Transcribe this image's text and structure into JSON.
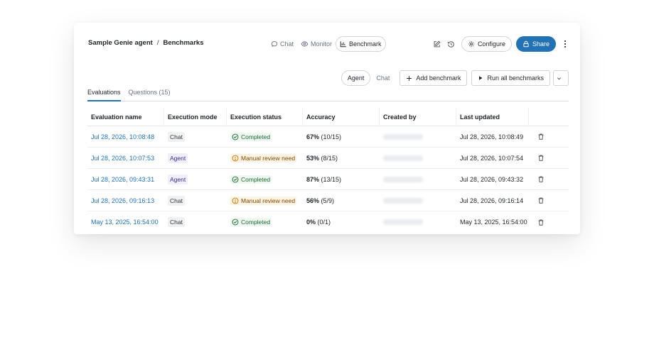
{
  "breadcrumb": {
    "agent": "Sample Genie agent",
    "separator": "/",
    "page": "Benchmarks"
  },
  "modes": [
    {
      "label": "Chat",
      "icon": "chat-bubble-icon",
      "active": false
    },
    {
      "label": "Monitor",
      "icon": "eye-icon",
      "active": false
    },
    {
      "label": "Benchmark",
      "icon": "bar-chart-icon",
      "active": true
    }
  ],
  "header": {
    "configure_label": "Configure",
    "share_label": "Share"
  },
  "toolbar": {
    "segment": [
      {
        "label": "Agent",
        "active": true
      },
      {
        "label": "Chat",
        "active": false
      }
    ],
    "add_benchmark_label": "Add benchmark",
    "run_all_label": "Run all benchmarks"
  },
  "tabs": [
    {
      "label": "Evaluations",
      "active": true
    },
    {
      "label": "Questions (15)",
      "active": false
    }
  ],
  "table": {
    "columns": [
      "Evaluation name",
      "Execution mode",
      "Execution status",
      "Accuracy",
      "Created by",
      "Last updated",
      ""
    ],
    "rows": [
      {
        "name": "Jul 28, 2026, 10:08:48",
        "mode": "Chat",
        "status": "Completed",
        "status_type": "ok",
        "acc_pct": "67%",
        "acc_frac": "(10/15)",
        "updated": "Jul 28, 2026, 10:08:49"
      },
      {
        "name": "Jul 28, 2026, 10:07:53",
        "mode": "Agent",
        "status": "Manual review need",
        "status_type": "warn",
        "acc_pct": "53%",
        "acc_frac": "(8/15)",
        "updated": "Jul 28, 2026, 10:07:54"
      },
      {
        "name": "Jul 28, 2026, 09:43:31",
        "mode": "Agent",
        "status": "Completed",
        "status_type": "ok",
        "acc_pct": "87%",
        "acc_frac": "(13/15)",
        "updated": "Jul 28, 2026, 09:43:32"
      },
      {
        "name": "Jul 28, 2026, 09:16:13",
        "mode": "Chat",
        "status": "Manual review need",
        "status_type": "warn",
        "acc_pct": "56%",
        "acc_frac": "(5/9)",
        "updated": "Jul 28, 2026, 09:16:14"
      },
      {
        "name": "May 13, 2025, 16:54:00",
        "mode": "Chat",
        "status": "Completed",
        "status_type": "ok",
        "acc_pct": "0%",
        "acc_frac": "(0/1)",
        "updated": "May 13, 2025, 16:54:00"
      }
    ]
  },
  "colors": {
    "accent": "#2272b4",
    "success": "#1f6b35",
    "warning": "#c77700"
  }
}
